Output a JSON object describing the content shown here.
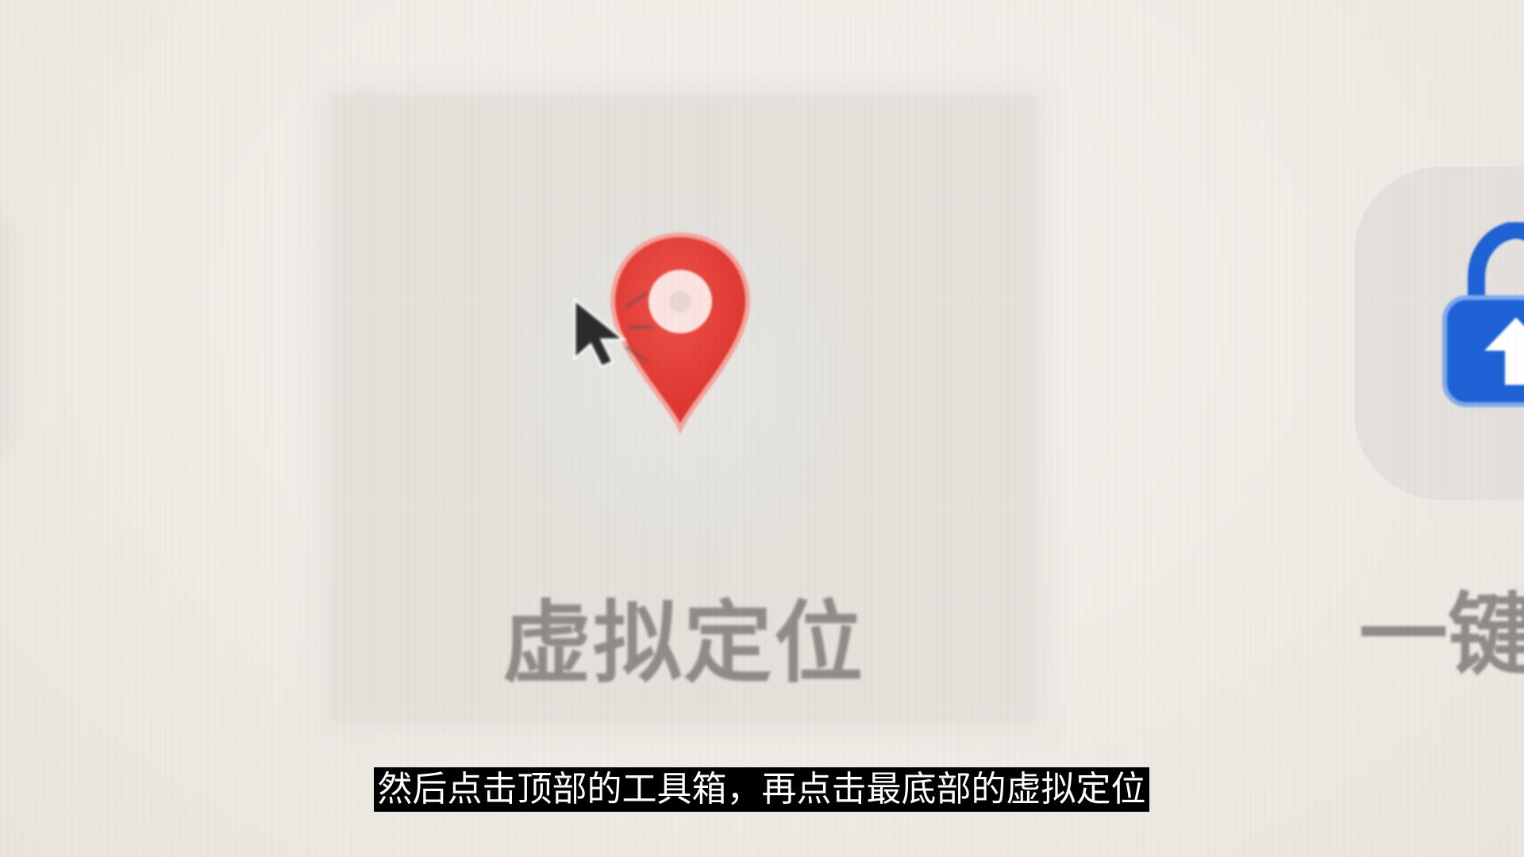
{
  "toolbox": {
    "items": [
      {
        "label": "虚拟定位",
        "icon": "location-pin-icon",
        "color": "#e53935",
        "selected": true
      },
      {
        "label": "一键",
        "icon": "lock-upload-icon",
        "color": "#1e62d6",
        "selected": false
      }
    ]
  },
  "cursor": {
    "icon": "mouse-cursor-icon"
  },
  "subtitle": {
    "text": "然后点击顶部的工具箱，再点击最底部的虚拟定位"
  }
}
